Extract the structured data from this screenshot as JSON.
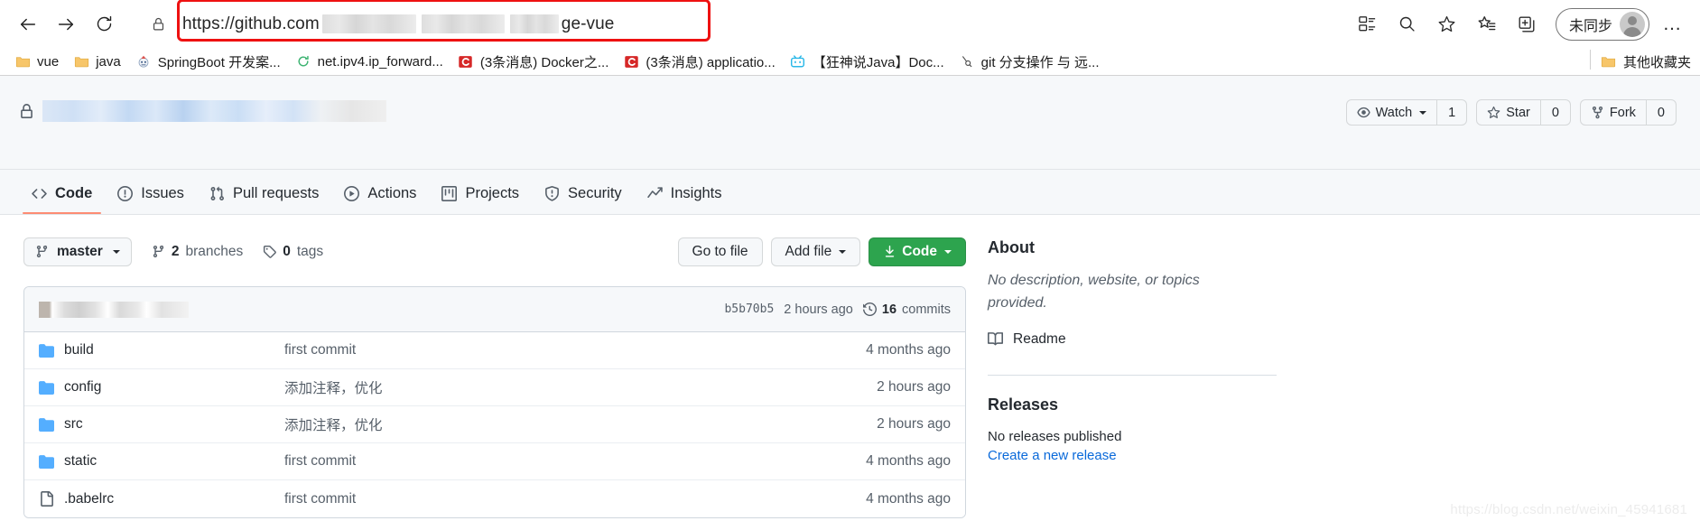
{
  "browser": {
    "nav": {
      "back": "back-arrow",
      "forward": "forward-arrow",
      "reload": "reload"
    },
    "address": {
      "lock": "lock-icon",
      "url_prefix": "https://github.com",
      "url_suffix": "ge-vue",
      "redacted": true,
      "highlight_color": "#ee1111"
    },
    "toolbar_icons": [
      "collections-icon",
      "search-icon",
      "favorite-star-icon",
      "favorites-list-icon",
      "add-collection-icon"
    ],
    "profile": {
      "label": "未同步",
      "avatar": "user-avatar"
    },
    "more_label": "…"
  },
  "bookmarks": [
    {
      "label": "vue",
      "icon": "folder-icon"
    },
    {
      "label": "java",
      "icon": "folder-icon"
    },
    {
      "label": "SpringBoot 开发案...",
      "icon": "site-icon"
    },
    {
      "label": "net.ipv4.ip_forward...",
      "icon": "site-icon"
    },
    {
      "label": "(3条消息) Docker之...",
      "icon": "csdn-icon"
    },
    {
      "label": "(3条消息) applicatio...",
      "icon": "csdn-icon"
    },
    {
      "label": "【狂神说Java】Doc...",
      "icon": "bilibili-icon"
    },
    {
      "label": "git 分支操作 与 远...",
      "icon": "site-icon"
    }
  ],
  "bookmarks_other": {
    "label": "其他收藏夹",
    "icon": "folder-icon"
  },
  "github": {
    "repo": {
      "visibility_icon": "lock-icon",
      "name_redacted": true
    },
    "repo_actions": [
      {
        "name": "watch",
        "label": "Watch",
        "icon": "eye-icon",
        "count": "1",
        "has_caret": true
      },
      {
        "name": "star",
        "label": "Star",
        "icon": "star-icon",
        "count": "0",
        "has_caret": false
      },
      {
        "name": "fork",
        "label": "Fork",
        "icon": "fork-icon",
        "count": "0",
        "has_caret": false
      }
    ],
    "tabs": [
      {
        "label": "Code",
        "icon": "code-icon",
        "active": true
      },
      {
        "label": "Issues",
        "icon": "issue-opened-icon",
        "active": false
      },
      {
        "label": "Pull requests",
        "icon": "git-pull-request-icon",
        "active": false
      },
      {
        "label": "Actions",
        "icon": "play-icon",
        "active": false
      },
      {
        "label": "Projects",
        "icon": "project-board-icon",
        "active": false
      },
      {
        "label": "Security",
        "icon": "shield-icon",
        "active": false
      },
      {
        "label": "Insights",
        "icon": "graph-icon",
        "active": false
      }
    ],
    "branch_bar": {
      "branch": "master",
      "branches_count": "2",
      "branches_label": "branches",
      "tags_count": "0",
      "tags_label": "tags",
      "go_to_file": "Go to file",
      "add_file": "Add file",
      "code": "Code"
    },
    "commit_bar": {
      "message_redacted": true,
      "sha": "b5b70b5",
      "time": "2 hours ago",
      "commits_count": "16",
      "commits_label": "commits"
    },
    "files": [
      {
        "name": "build",
        "type": "folder",
        "message": "first commit",
        "time": "4 months ago"
      },
      {
        "name": "config",
        "type": "folder",
        "message": "添加注释，优化",
        "time": "2 hours ago"
      },
      {
        "name": "src",
        "type": "folder",
        "message": "添加注释，优化",
        "time": "2 hours ago"
      },
      {
        "name": "static",
        "type": "folder",
        "message": "first commit",
        "time": "4 months ago"
      },
      {
        "name": ".babelrc",
        "type": "file",
        "message": "first commit",
        "time": "4 months ago"
      }
    ],
    "about": {
      "title": "About",
      "description": "No description, website, or topics provided.",
      "readme_label": "Readme"
    },
    "releases": {
      "title": "Releases",
      "empty_text": "No releases published",
      "create_link": "Create a new release"
    }
  },
  "watermark": "https://blog.csdn.net/weixin_45941681"
}
